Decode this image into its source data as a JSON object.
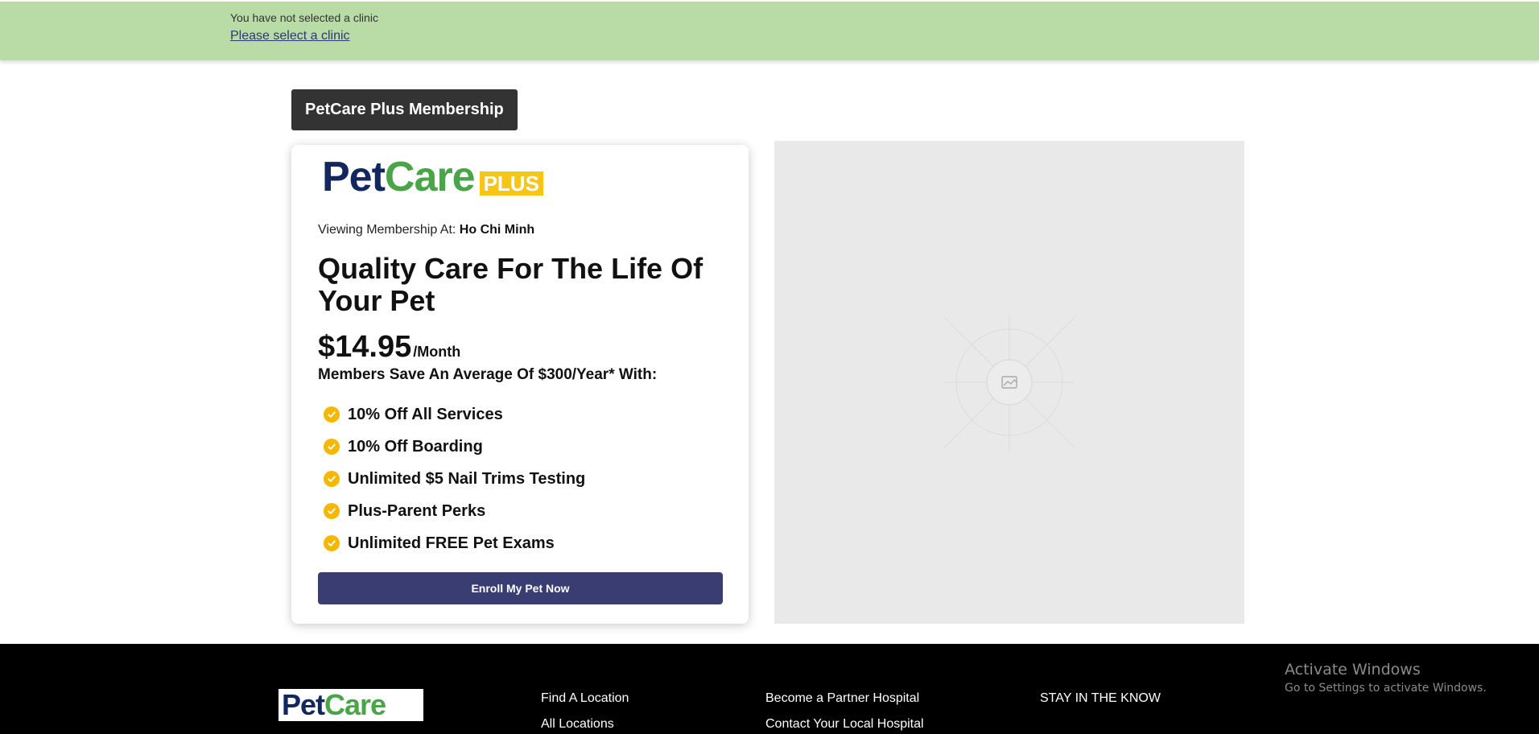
{
  "alert": {
    "message": "You have not selected a clinic",
    "link_label": "Please select a clinic"
  },
  "page_title": "PetCare Plus Membership",
  "card": {
    "logo": {
      "pet": "Pet",
      "care": "Care",
      "plus": "PLUS"
    },
    "viewing_prefix": "Viewing Membership At:",
    "viewing_location": "Ho Chi Minh",
    "headline": "Quality Care For The Life Of Your Pet",
    "price": "$14.95",
    "price_period": "/Month",
    "savings_text": "Members Save An Average Of $300/Year* With:",
    "benefits": [
      "10% Off All Services",
      "10% Off Boarding",
      "Unlimited $5 Nail Trims Testing",
      "Plus-Parent Perks",
      "Unlimited FREE Pet Exams"
    ],
    "enroll_label": "Enroll My Pet Now"
  },
  "footer": {
    "logo": {
      "pet": "Pet",
      "care": "Care"
    },
    "col1": [
      "Find A Location",
      "All Locations"
    ],
    "col2": [
      "Become a Partner Hospital",
      "Contact Your Local Hospital"
    ],
    "col3": [
      "STAY IN THE KNOW"
    ]
  },
  "watermark": {
    "title": "Activate Windows",
    "subtitle": "Go to Settings to activate Windows."
  },
  "colors": {
    "alert_bg": "#b9dca6",
    "brand_navy": "#13275f",
    "brand_green": "#4aa448",
    "brand_yellow": "#f5c518",
    "button_bg": "#3a3d72",
    "badge_bg": "#333333"
  }
}
